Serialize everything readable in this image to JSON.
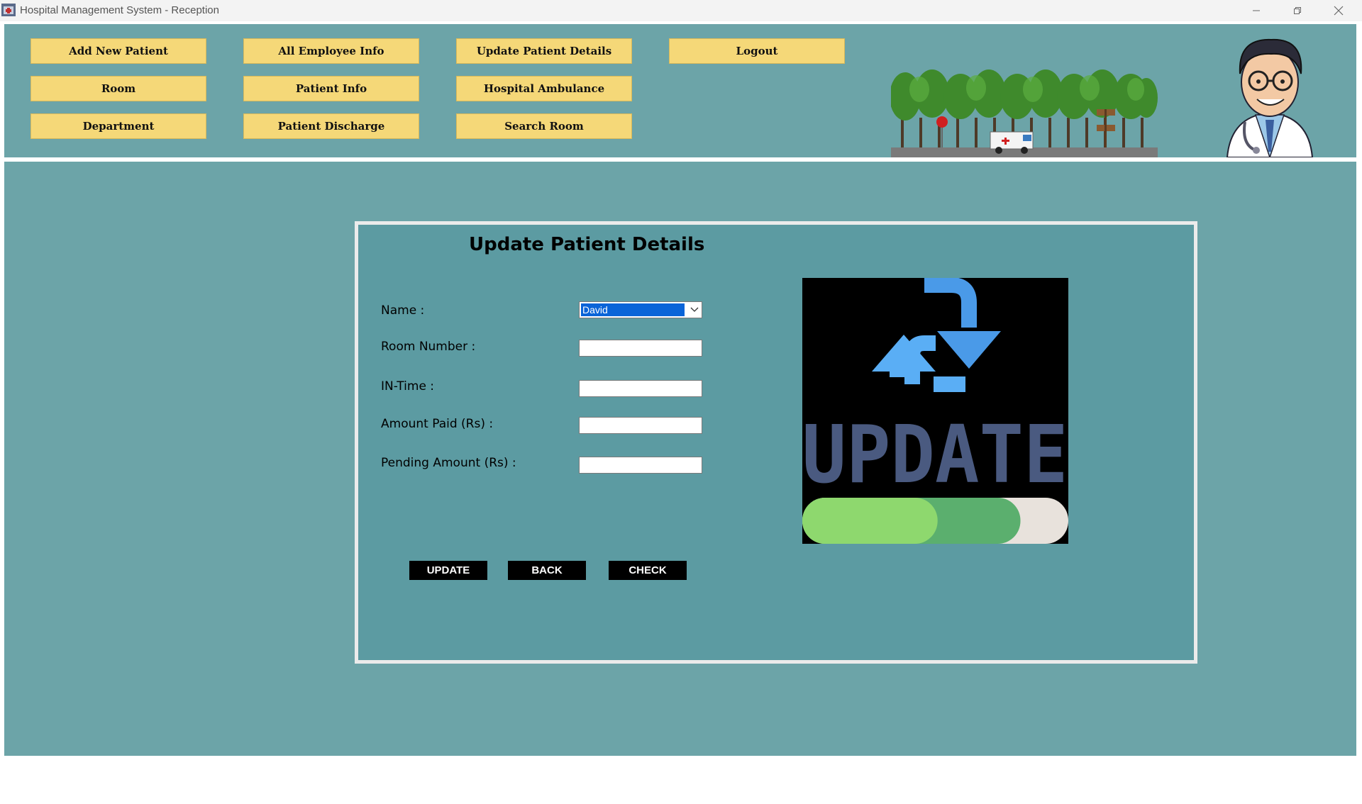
{
  "window": {
    "title": "Hospital Management System - Reception",
    "app_icon": "hospital-app-icon",
    "controls": [
      "minimize-icon",
      "restore-icon",
      "close-icon"
    ]
  },
  "nav": {
    "add_new_patient": "Add New Patient",
    "all_employee_info": "All Employee Info",
    "update_patient_details": "Update Patient Details",
    "logout": "Logout",
    "room": "Room",
    "patient_info": "Patient Info",
    "hospital_ambulance": "Hospital Ambulance",
    "department": "Department",
    "patient_discharge": "Patient Discharge",
    "search_room": "Search Room"
  },
  "form": {
    "title": "Update Patient Details",
    "name_label": "Name :",
    "name_value": "David",
    "room_number_label": "Room Number :",
    "room_number_value": "",
    "in_time_label": "IN-Time :",
    "in_time_value": "",
    "amount_paid_label": "Amount Paid (Rs) :",
    "amount_paid_value": "",
    "pending_amount_label": "Pending Amount (Rs) :",
    "pending_amount_value": ""
  },
  "actions": {
    "update": "UPDATE",
    "back": "BACK",
    "check": "CHECK"
  },
  "update_image": {
    "word": "UPDATE",
    "progress": 0.82,
    "icon": "refresh-arrows-icon"
  },
  "colors": {
    "panel_bg": "#6ca4a8",
    "card_bg": "#5c9ba2",
    "nav_button": "#f5d878",
    "action_button": "#000000",
    "selection": "#0a64d8"
  }
}
